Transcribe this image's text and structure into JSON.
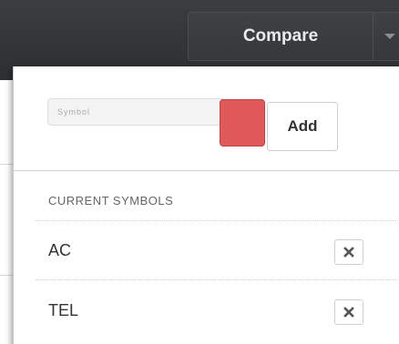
{
  "toolbar": {
    "compare_label": "Compare"
  },
  "add_form": {
    "symbol_placeholder": "Symbol",
    "swatch_color": "#e05a5a",
    "add_label": "Add"
  },
  "current_symbols": {
    "header": "CURRENT SYMBOLS",
    "items": [
      {
        "label": "AC"
      },
      {
        "label": "TEL"
      }
    ]
  }
}
